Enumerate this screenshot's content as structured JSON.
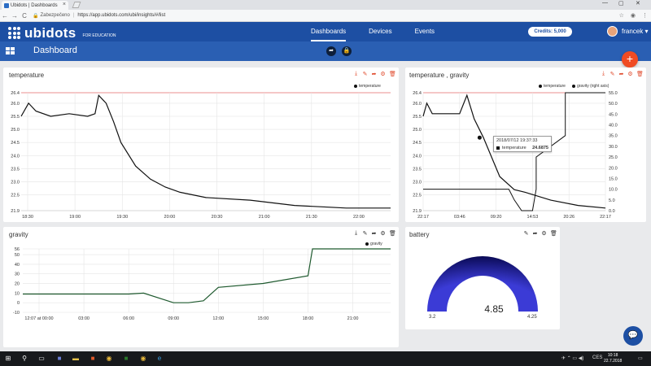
{
  "browser": {
    "tab_title": "Ubidots | Dashboards",
    "tab_close": "×",
    "window_controls": [
      "—",
      "▢",
      "✕"
    ],
    "nav_back": "←",
    "nav_forward": "→",
    "nav_reload": "C",
    "secure_label": "Zabezpečeno",
    "url": "https://app.ubidots.com/ubi/insights/#/list"
  },
  "app": {
    "brand": "ubidots",
    "brand_sub": "FOR EDUCATION",
    "nav": [
      "Dashboards",
      "Devices",
      "Events"
    ],
    "active_nav": "Dashboards",
    "credits": "Credits: 5,000",
    "user": "francek ▾"
  },
  "dashboard": {
    "title": "Dashboard",
    "add_label": "+"
  },
  "widgets": {
    "temperature": {
      "title": "temperature",
      "legend": "temperature",
      "y_ticks": [
        "26.4",
        "26.0",
        "25.5",
        "25.0",
        "24.5",
        "24.0",
        "23.5",
        "23.0",
        "22.5",
        "21.9"
      ],
      "x_ticks": [
        "18:30",
        "19:00",
        "19:30",
        "20:00",
        "20:30",
        "21:00",
        "21:30",
        "22:00"
      ]
    },
    "temp_gravity": {
      "title": "temperature , gravity",
      "legend_1": "temperature",
      "legend_2": "gravity (right axis)",
      "y_ticks": [
        "26.4",
        "26.0",
        "25.5",
        "25.0",
        "24.5",
        "24.0",
        "23.5",
        "23.0",
        "22.5",
        "21.9"
      ],
      "y2_ticks": [
        "55.0",
        "50.0",
        "45.0",
        "40.0",
        "35.0",
        "30.0",
        "25.0",
        "20.0",
        "15.0",
        "10.0",
        "5.0",
        "0.0"
      ],
      "x_ticks": [
        "22:17",
        "03:46",
        "09:20",
        "14:53",
        "20:26",
        "22:17"
      ],
      "tooltip_time": "2018/07/12 19:37:33",
      "tooltip_series": "temperature",
      "tooltip_value": "24.6875"
    },
    "gravity": {
      "title": "gravity",
      "legend": "gravity",
      "y_ticks": [
        "56",
        "50",
        "40",
        "30",
        "20",
        "10",
        "0",
        "-10"
      ],
      "x_ticks": [
        "12:07 at 00:00",
        "03:00",
        "06:00",
        "09:00",
        "12:00",
        "15:00",
        "18:00",
        "21:00"
      ]
    },
    "battery": {
      "title": "battery",
      "value": "4.85",
      "min": "3.2",
      "max": "4.25"
    }
  },
  "chart_data": [
    {
      "type": "line",
      "title": "temperature",
      "x_labels": [
        "18:30",
        "19:00",
        "19:30",
        "20:00",
        "20:30",
        "21:00",
        "21:30",
        "22:00"
      ],
      "series": [
        {
          "name": "temperature",
          "x": [
            "18:20",
            "18:25",
            "18:30",
            "18:40",
            "18:50",
            "19:00",
            "19:10",
            "19:15",
            "19:20",
            "19:25",
            "19:30",
            "19:40",
            "19:50",
            "20:00",
            "20:10",
            "20:30",
            "21:00",
            "21:30",
            "22:00",
            "22:15"
          ],
          "y": [
            25.5,
            26.0,
            25.7,
            25.5,
            25.6,
            25.5,
            25.6,
            26.3,
            26.0,
            25.3,
            24.5,
            23.6,
            23.1,
            22.8,
            22.6,
            22.4,
            22.3,
            22.1,
            22.0,
            22.0
          ]
        }
      ],
      "ylim": [
        21.9,
        26.4
      ]
    },
    {
      "type": "line",
      "title": "temperature , gravity",
      "x_labels": [
        "22:17",
        "03:46",
        "09:20",
        "14:53",
        "20:26",
        "22:17"
      ],
      "series": [
        {
          "name": "temperature",
          "y": [
            25.5,
            26.0,
            25.6,
            25.6,
            26.3,
            25.4,
            24.7,
            23.2,
            22.7,
            22.6,
            22.3,
            22.1,
            22.0
          ]
        },
        {
          "name": "gravity (right axis)",
          "y": [
            10,
            10,
            10,
            10,
            5,
            0,
            0,
            10,
            25,
            35,
            55,
            55
          ]
        }
      ],
      "ylim": [
        21.9,
        26.4
      ],
      "y2lim": [
        0,
        55
      ]
    },
    {
      "type": "line",
      "title": "gravity",
      "x_labels": [
        "12:07 at 00:00",
        "03:00",
        "06:00",
        "09:00",
        "12:00",
        "15:00",
        "18:00",
        "21:00"
      ],
      "series": [
        {
          "name": "gravity",
          "x_hours": [
            0,
            3,
            6,
            7,
            9,
            10,
            11,
            12,
            15,
            18,
            18.3,
            21,
            24
          ],
          "y": [
            9,
            9,
            9,
            10,
            0,
            0,
            2,
            16,
            20,
            28,
            56,
            56,
            56
          ]
        }
      ],
      "ylim": [
        -10,
        56
      ]
    }
  ]
}
